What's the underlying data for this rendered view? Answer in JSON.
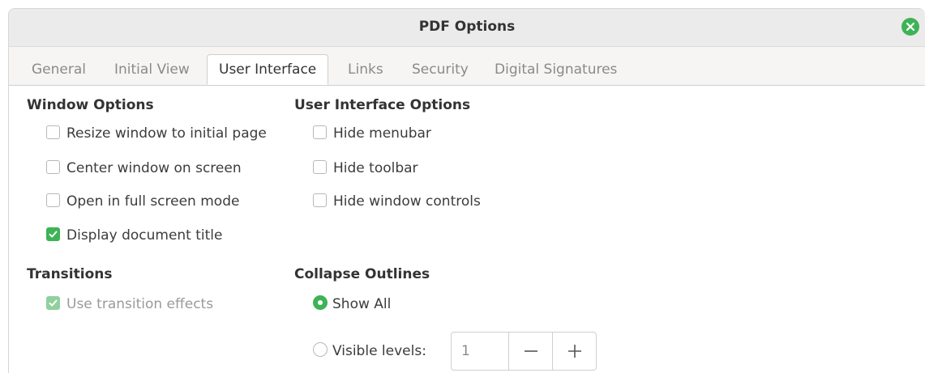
{
  "dialog": {
    "title": "PDF Options"
  },
  "tabs": [
    {
      "label": "General"
    },
    {
      "label": "Initial View"
    },
    {
      "label": "User Interface"
    },
    {
      "label": "Links"
    },
    {
      "label": "Security"
    },
    {
      "label": "Digital Signatures"
    }
  ],
  "active_tab": "User Interface",
  "window_options": {
    "title": "Window Options",
    "items": [
      {
        "label": "Resize window to initial page",
        "checked": false
      },
      {
        "label": "Center window on screen",
        "checked": false
      },
      {
        "label": "Open in full screen mode",
        "checked": false
      },
      {
        "label": "Display document title",
        "checked": true
      }
    ]
  },
  "ui_options": {
    "title": "User Interface Options",
    "items": [
      {
        "label": "Hide menubar",
        "checked": false
      },
      {
        "label": "Hide toolbar",
        "checked": false
      },
      {
        "label": "Hide window controls",
        "checked": false
      }
    ]
  },
  "transitions": {
    "title": "Transitions",
    "use_effects": {
      "label": "Use transition effects",
      "checked": true,
      "enabled": false
    }
  },
  "collapse_outlines": {
    "title": "Collapse Outlines",
    "show_all": {
      "label": "Show All",
      "selected": true
    },
    "visible_levels": {
      "label": "Visible levels:",
      "selected": false,
      "value": "1"
    }
  },
  "colors": {
    "accent": "#3eb356"
  }
}
